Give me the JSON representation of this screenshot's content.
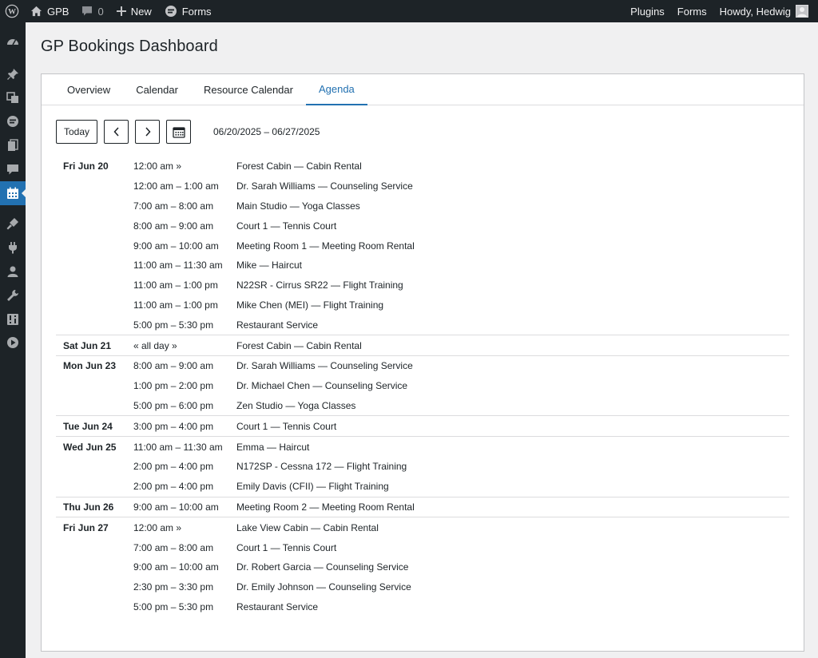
{
  "adminbar": {
    "site_name": "GPB",
    "comments_count": "0",
    "new_label": "New",
    "forms_label": "Forms",
    "plugins_label": "Plugins",
    "forms_right_label": "Forms",
    "howdy_label": "Howdy, Hedwig"
  },
  "page": {
    "title": "GP Bookings Dashboard"
  },
  "tabs": [
    {
      "label": "Overview"
    },
    {
      "label": "Calendar"
    },
    {
      "label": "Resource Calendar"
    },
    {
      "label": "Agenda",
      "active": true
    }
  ],
  "toolbar": {
    "today_label": "Today",
    "prev_icon": "chevron-left-icon",
    "next_icon": "chevron-right-icon",
    "calendar_icon": "calendar-icon",
    "date_range": "06/20/2025 – 06/27/2025"
  },
  "agenda": [
    {
      "day": "Fri Jun 20",
      "events": [
        {
          "time": "12:00 am »",
          "title": "Forest Cabin — Cabin Rental"
        },
        {
          "time": "12:00 am – 1:00 am",
          "title": "Dr. Sarah Williams — Counseling Service"
        },
        {
          "time": "7:00 am – 8:00 am",
          "title": "Main Studio — Yoga Classes"
        },
        {
          "time": "8:00 am – 9:00 am",
          "title": "Court 1 — Tennis Court"
        },
        {
          "time": "9:00 am – 10:00 am",
          "title": "Meeting Room 1 — Meeting Room Rental"
        },
        {
          "time": "11:00 am – 11:30 am",
          "title": "Mike — Haircut"
        },
        {
          "time": "11:00 am – 1:00 pm",
          "title": "N22SR - Cirrus SR22 — Flight Training"
        },
        {
          "time": "11:00 am – 1:00 pm",
          "title": "Mike Chen (MEI) — Flight Training"
        },
        {
          "time": "5:00 pm – 5:30 pm",
          "title": "Restaurant Service"
        }
      ]
    },
    {
      "day": "Sat Jun 21",
      "events": [
        {
          "time": "« all day »",
          "title": "Forest Cabin — Cabin Rental"
        }
      ]
    },
    {
      "day": "Mon Jun 23",
      "events": [
        {
          "time": "8:00 am – 9:00 am",
          "title": "Dr. Sarah Williams — Counseling Service"
        },
        {
          "time": "1:00 pm – 2:00 pm",
          "title": "Dr. Michael Chen — Counseling Service"
        },
        {
          "time": "5:00 pm – 6:00 pm",
          "title": "Zen Studio — Yoga Classes"
        }
      ]
    },
    {
      "day": "Tue Jun 24",
      "events": [
        {
          "time": "3:00 pm – 4:00 pm",
          "title": "Court 1 — Tennis Court"
        }
      ]
    },
    {
      "day": "Wed Jun 25",
      "events": [
        {
          "time": "11:00 am – 11:30 am",
          "title": "Emma — Haircut"
        },
        {
          "time": "2:00 pm – 4:00 pm",
          "title": "N172SP - Cessna 172 — Flight Training"
        },
        {
          "time": "2:00 pm – 4:00 pm",
          "title": "Emily Davis (CFII) — Flight Training"
        }
      ]
    },
    {
      "day": "Thu Jun 26",
      "events": [
        {
          "time": "9:00 am – 10:00 am",
          "title": "Meeting Room 2 — Meeting Room Rental"
        }
      ]
    },
    {
      "day": "Fri Jun 27",
      "events": [
        {
          "time": "12:00 am »",
          "title": "Lake View Cabin — Cabin Rental"
        },
        {
          "time": "7:00 am – 8:00 am",
          "title": "Court 1 — Tennis Court"
        },
        {
          "time": "9:00 am – 10:00 am",
          "title": "Dr. Robert Garcia — Counseling Service"
        },
        {
          "time": "2:30 pm – 3:30 pm",
          "title": "Dr. Emily Johnson — Counseling Service"
        },
        {
          "time": "5:00 pm – 5:30 pm",
          "title": "Restaurant Service"
        }
      ]
    }
  ],
  "sidebar_icons": [
    "dashboard-icon",
    "pin-icon",
    "media-icon",
    "forms-icon",
    "pages-icon",
    "comments-icon",
    "bookings-icon",
    "appearance-icon",
    "plugins-icon",
    "users-icon",
    "tools-icon",
    "settings-icon",
    "play-icon"
  ],
  "colors": {
    "adminbar_bg": "#1d2327",
    "accent": "#2271b1",
    "page_bg": "#f0f0f1"
  }
}
